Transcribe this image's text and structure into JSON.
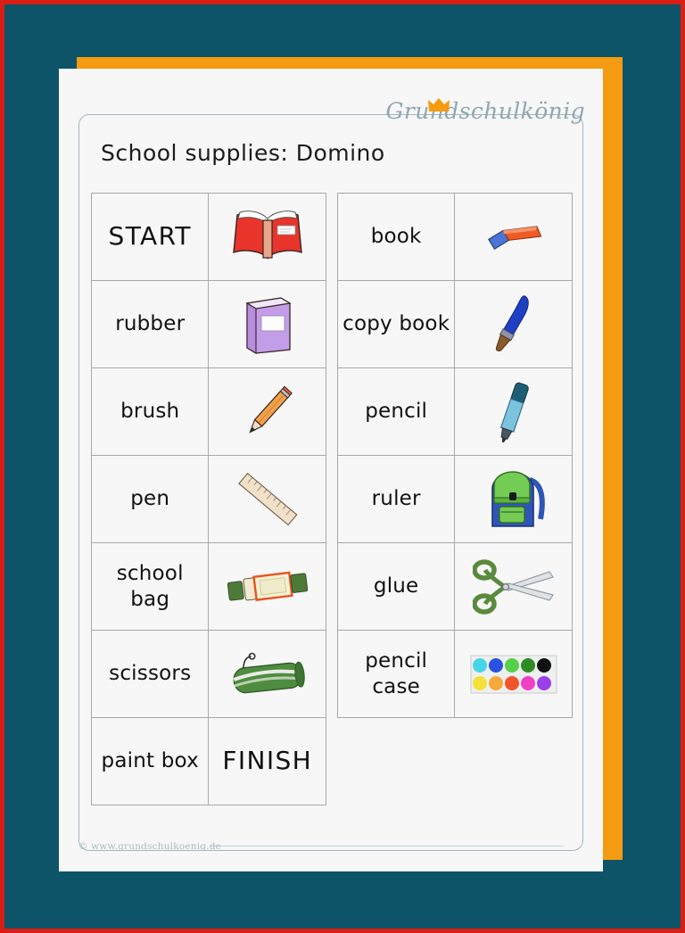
{
  "page": {
    "background_color": "#0d5468",
    "border_color": "#d81f16",
    "accent_color": "#f59b11",
    "paper_color": "#f7f7f7",
    "frame_color": "#9fb8bd"
  },
  "brand": {
    "name": "Grundschulkönig",
    "crown_icon": "crown-icon",
    "crown_color": "#f59b11",
    "text_color": "#8fa7b2"
  },
  "title": "School supplies: Domino",
  "footer": {
    "copyright": "© www.grundschulkoenig.de"
  },
  "left_table": {
    "rows": [
      {
        "word": "START",
        "emphasis": true,
        "picture": "open-red-book-icon"
      },
      {
        "word": "rubber",
        "emphasis": false,
        "picture": "purple-closed-book-icon"
      },
      {
        "word": "brush",
        "emphasis": false,
        "picture": "orange-pencil-icon"
      },
      {
        "word": "pen",
        "emphasis": false,
        "picture": "wooden-ruler-icon"
      },
      {
        "word": "school\nbag",
        "emphasis": false,
        "picture": "glue-stick-icon"
      },
      {
        "word": "scissors",
        "emphasis": false,
        "picture": "green-pencil-case-icon"
      },
      {
        "word": "paint box",
        "emphasis": false,
        "picture": "finish-text",
        "picture_text": "FINISH"
      }
    ]
  },
  "right_table": {
    "rows": [
      {
        "word": "book",
        "picture": "eraser-icon"
      },
      {
        "word": "copy book",
        "picture": "blue-paintbrush-icon"
      },
      {
        "word": "pencil",
        "picture": "blue-pen-icon"
      },
      {
        "word": "ruler",
        "picture": "green-backpack-icon"
      },
      {
        "word": "glue",
        "picture": "green-scissors-icon"
      },
      {
        "word": "pencil\ncase",
        "picture": "paint-box-icon"
      }
    ]
  },
  "paint_box_colors": [
    "#45d6e8",
    "#2a52e0",
    "#55d14a",
    "#2f8a24",
    "#111111",
    "#f5e03a",
    "#f5a93a",
    "#f2542a",
    "#ef3fc4",
    "#9b3fe8"
  ]
}
